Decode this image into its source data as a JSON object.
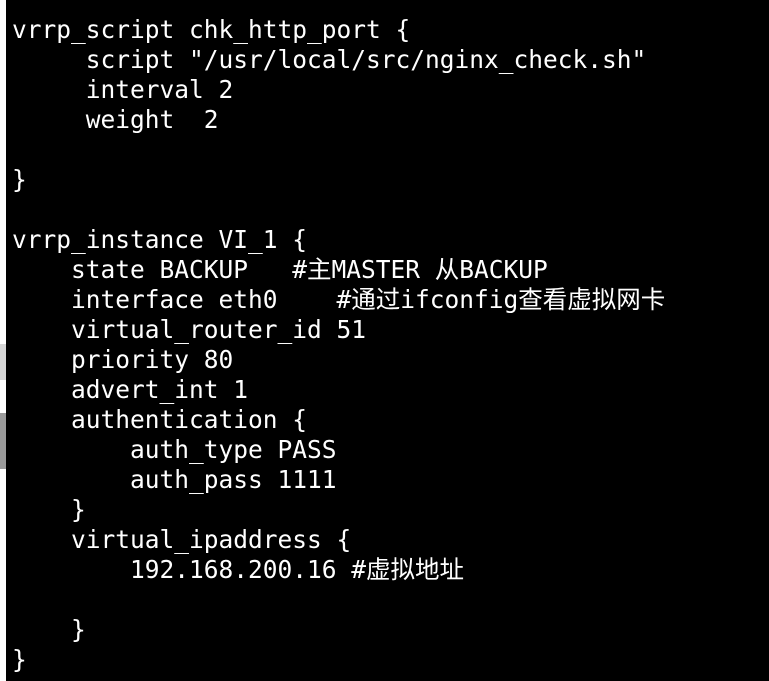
{
  "terminal": {
    "lines": [
      "vrrp_script chk_http_port {",
      "     script \"/usr/local/src/nginx_check.sh\"",
      "     interval 2",
      "     weight  2",
      "",
      "}",
      "",
      "vrrp_instance VI_1 {",
      "    state BACKUP   #主MASTER 从BACKUP",
      "    interface eth0    #通过ifconfig查看虚拟网卡",
      "    virtual_router_id 51",
      "    priority 80",
      "    advert_int 1",
      "    authentication {",
      "        auth_type PASS",
      "        auth_pass 1111",
      "    }",
      "    virtual_ipaddress {",
      "        192.168.200.16 #虚拟地址",
      "",
      "    }",
      "}"
    ]
  },
  "colors": {
    "background": "#000000",
    "text": "#ffffff"
  }
}
